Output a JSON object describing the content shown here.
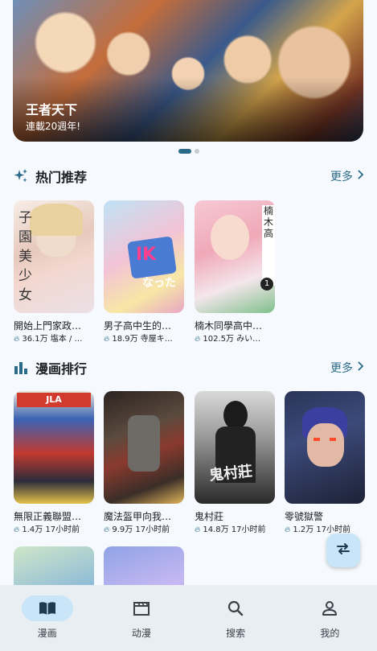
{
  "banner": {
    "title": "王者天下",
    "subtitle": "連載20週年!"
  },
  "carousel": {
    "page_count": 2,
    "active_index": 0
  },
  "hot": {
    "title": "热门推荐",
    "more": "更多",
    "items": [
      {
        "title": "開始上門家政…",
        "meta": "36.1万 塩本 / …"
      },
      {
        "title": "男子高中生的…",
        "meta": "18.9万 寺屋キ…"
      },
      {
        "title": "楠木同學高中…",
        "meta": "102.5万 みい…"
      }
    ]
  },
  "rank": {
    "title": "漫画排行",
    "more": "更多",
    "items": [
      {
        "title": "無限正義聯盟…",
        "meta": "1.4万 17小时前"
      },
      {
        "title": "魔法盔甲向我…",
        "meta": "9.9万 17小时前"
      },
      {
        "title": "鬼村莊",
        "meta": "14.8万 17小时前"
      },
      {
        "title": "零號獄警",
        "meta": "1.2万 17小时前"
      }
    ]
  },
  "nav": {
    "items": [
      {
        "label": "漫画",
        "icon": "book-icon",
        "active": true
      },
      {
        "label": "动漫",
        "icon": "clapperboard-icon",
        "active": false
      },
      {
        "label": "搜索",
        "icon": "search-icon",
        "active": false
      },
      {
        "label": "我的",
        "icon": "person-icon",
        "active": false
      }
    ]
  },
  "colors": {
    "accent": "#2b6b8a",
    "nav_active_bg": "#c8e6f7",
    "background": "#f6f9fd"
  }
}
